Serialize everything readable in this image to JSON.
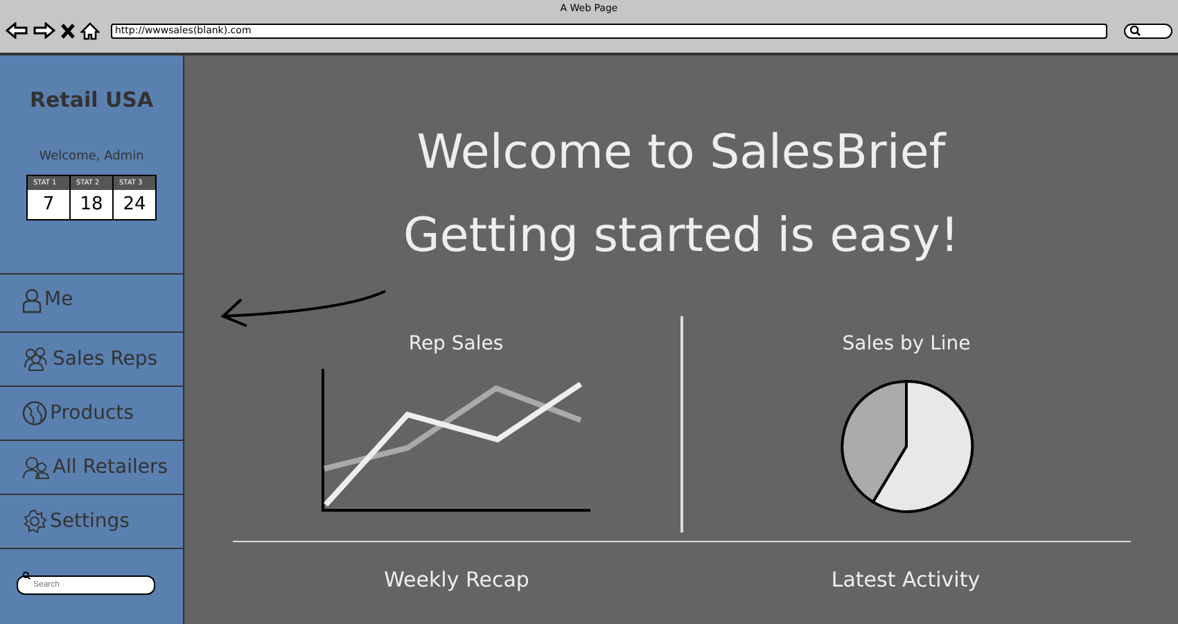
{
  "window": {
    "title": "A Web Page"
  },
  "browser": {
    "url": "http://wwwsales(blank).com"
  },
  "sidebar": {
    "brand": "Retail USA",
    "welcome": "Welcome, Admin",
    "stats": [
      {
        "label": "STAT 1",
        "value": "7"
      },
      {
        "label": "STAT 2",
        "value": "18"
      },
      {
        "label": "STAT 3",
        "value": "24"
      }
    ],
    "items": [
      {
        "label": "Me",
        "kind": "person"
      },
      {
        "label": "Sales Reps",
        "kind": "group"
      },
      {
        "label": "Products",
        "kind": "globe"
      },
      {
        "label": "All Retailers",
        "kind": "people"
      },
      {
        "label": "Settings",
        "kind": "gear"
      }
    ],
    "search": {
      "placeholder": "Search"
    }
  },
  "main": {
    "headline": "Welcome to SalesBrief",
    "subheadline": "Getting started is easy!",
    "panels": [
      {
        "title": "Rep Sales",
        "kind": "line"
      },
      {
        "title": "Sales by Line",
        "kind": "pie"
      }
    ],
    "sections": [
      "Weekly Recap",
      "Latest Activity"
    ]
  }
}
